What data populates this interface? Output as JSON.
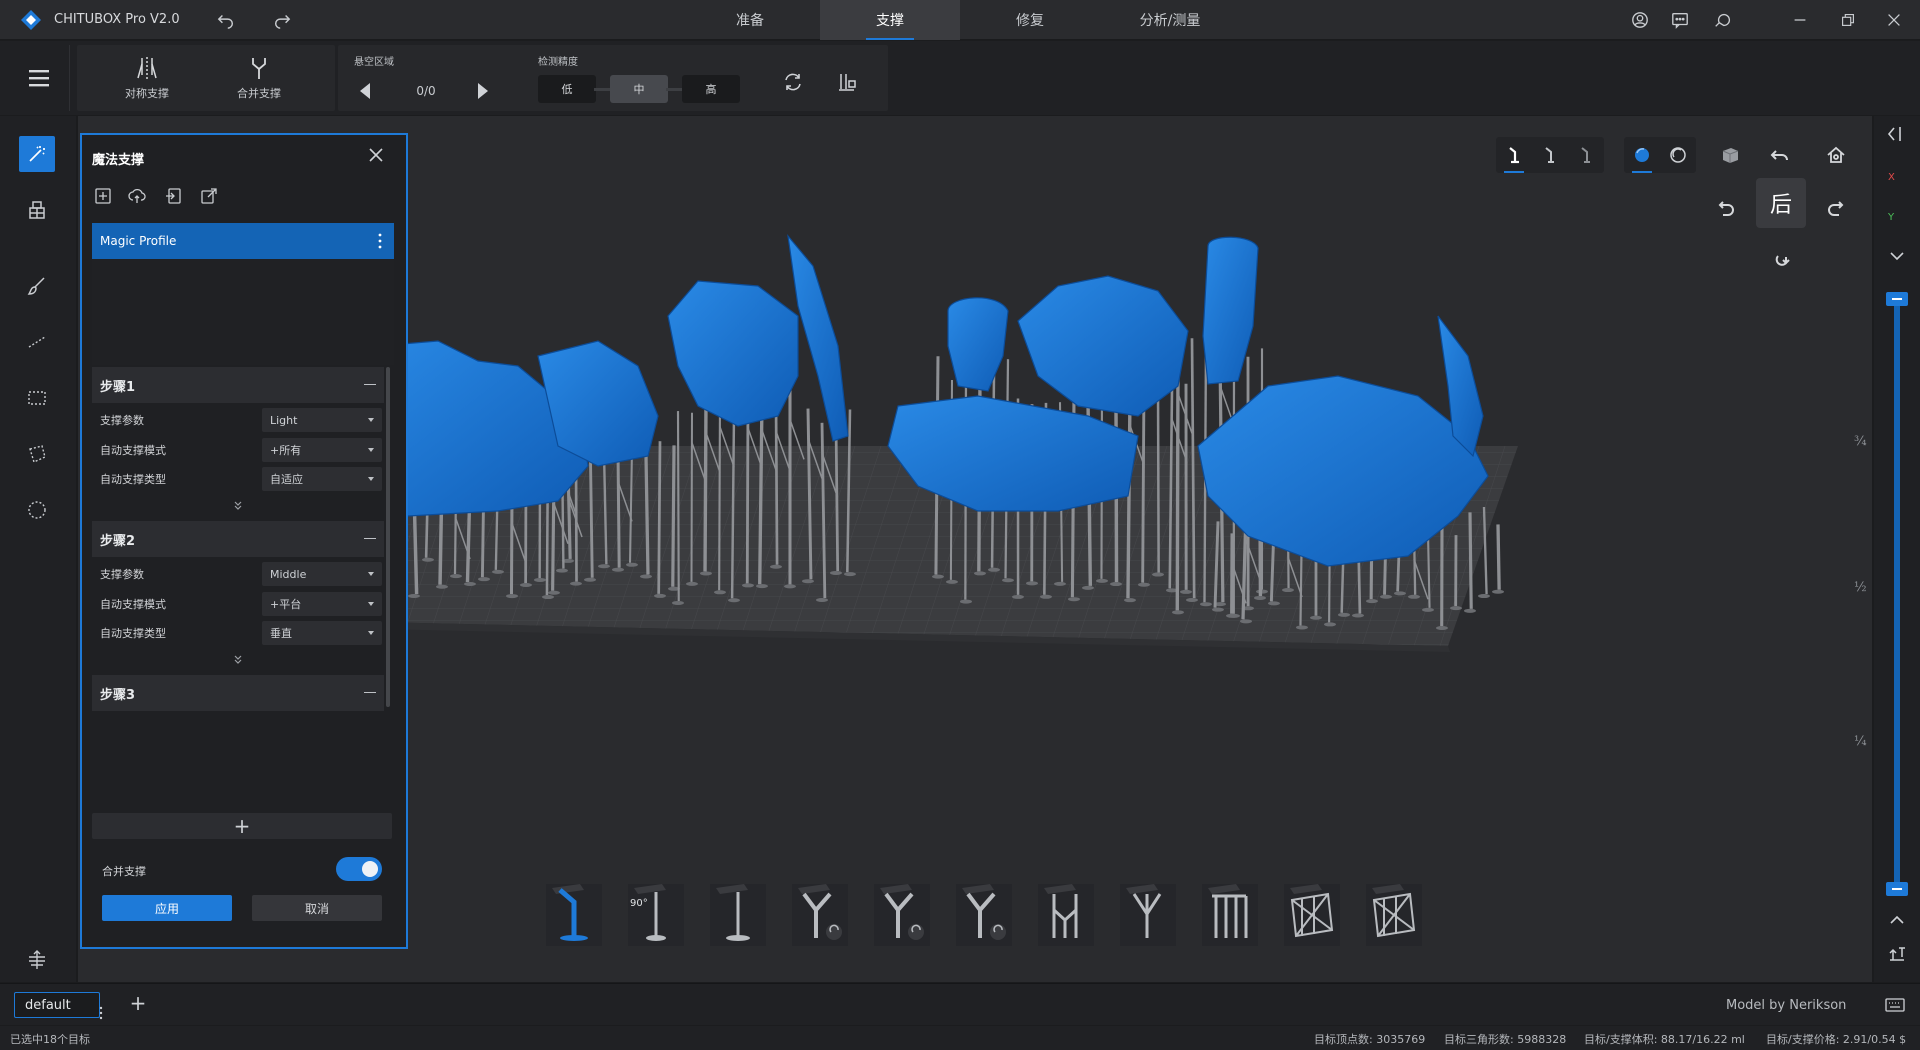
{
  "app": {
    "title": "CHITUBOX Pro V2.0"
  },
  "modes": [
    {
      "label": "准备",
      "active": false
    },
    {
      "label": "支撑",
      "active": true
    },
    {
      "label": "修复",
      "active": false
    },
    {
      "label": "分析/测量",
      "active": false
    }
  ],
  "toolbar": {
    "symmetric_support": "对称支撑",
    "merge_support": "合并支撑",
    "overhang_label": "悬空区域",
    "overhang_count": "0/0",
    "precision_label": "检测精度",
    "precision_low": "低",
    "precision_mid": "中",
    "precision_high": "高",
    "precision_selected": "中"
  },
  "panel": {
    "title": "魔法支撑",
    "profile_name": "Magic Profile",
    "steps": [
      {
        "title": "步骤1",
        "params": [
          {
            "label": "支撑参数",
            "value": "Light"
          },
          {
            "label": "自动支撑模式",
            "value": "+所有"
          },
          {
            "label": "自动支撑类型",
            "value": "自适应"
          }
        ]
      },
      {
        "title": "步骤2",
        "params": [
          {
            "label": "支撑参数",
            "value": "Middle"
          },
          {
            "label": "自动支撑模式",
            "value": "+平台"
          },
          {
            "label": "自动支撑类型",
            "value": "垂直"
          }
        ]
      },
      {
        "title": "步骤3",
        "params": []
      }
    ],
    "add_step": "+",
    "merge_support_label": "合并支撑",
    "merge_support_enabled": true,
    "apply": "应用",
    "cancel": "取消"
  },
  "view": {
    "cube_face": "后"
  },
  "axes": {
    "x": "X",
    "y": "Y"
  },
  "layer_scale": {
    "three_quarter": "¾",
    "half": "½",
    "quarter": "¼"
  },
  "support_palette": [
    {
      "icon": "auto-pillar-icon",
      "active": true
    },
    {
      "icon": "angle-90-support-icon",
      "label": "90°"
    },
    {
      "icon": "vertical-support-icon"
    },
    {
      "icon": "branch-support-icon"
    },
    {
      "icon": "tilted-branch-support-icon"
    },
    {
      "icon": "split-branch-support-icon"
    },
    {
      "icon": "double-tree-support-icon"
    },
    {
      "icon": "tree-support-icon"
    },
    {
      "icon": "bridge-support-icon"
    },
    {
      "icon": "lattice-support-icon"
    },
    {
      "icon": "raft-lattice-support-icon"
    }
  ],
  "scene": {
    "tab_name": "default",
    "add": "+",
    "credit": "Model by Nerikson"
  },
  "status": {
    "selection": "已选中18个目标",
    "vertices": "目标顶点数: 3035769",
    "triangles": "目标三角形数: 5988328",
    "volume": "目标/支撑体积: 88.17/16.22 ml",
    "price": "目标/支撑价格: 2.91/0.54 $"
  },
  "colors": {
    "accent": "#1e7ad8",
    "model": "#1a6fd0",
    "support": "#8e9094",
    "plate": "#3e3f42"
  }
}
